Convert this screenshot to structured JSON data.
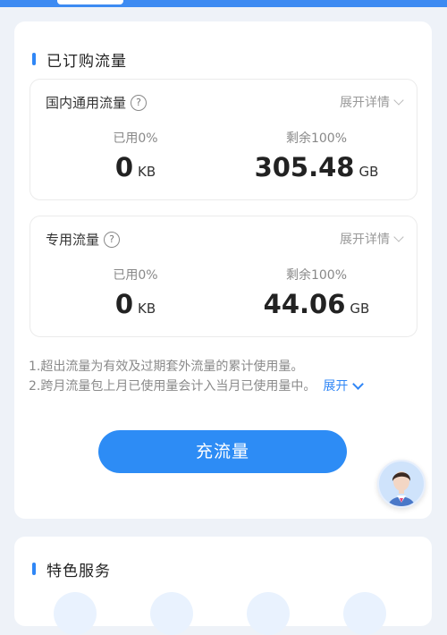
{
  "purchased": {
    "title": "已订购流量",
    "domestic": {
      "name": "国内通用流量",
      "help_glyph": "?",
      "expand_label": "展开详情",
      "used_label": "已用0%",
      "used_value": "0",
      "used_unit": "KB",
      "remaining_label": "剩余100%",
      "remaining_value": "305.48",
      "remaining_unit": "GB"
    },
    "dedicated": {
      "name": "专用流量",
      "help_glyph": "?",
      "expand_label": "展开详情",
      "used_label": "已用0%",
      "used_value": "0",
      "used_unit": "KB",
      "remaining_label": "剩余100%",
      "remaining_value": "44.06",
      "remaining_unit": "GB"
    },
    "notes": {
      "line1": "1.超出流量为有效及过期套外流量的累计使用量。",
      "line2": "2.跨月流量包上月已使用量会计入当月已使用量中。",
      "expand_label": "展开"
    },
    "recharge_label": "充流量"
  },
  "features": {
    "title": "特色服务"
  },
  "colors": {
    "accent": "#2d8cf5",
    "background": "#eef2f8"
  },
  "icons": {
    "help": "help-circle-icon",
    "chevron": "chevron-down-icon",
    "assistant": "assistant-avatar-icon"
  }
}
